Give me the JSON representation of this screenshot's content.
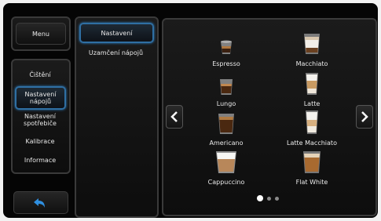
{
  "left_menu": {
    "menu_label": "Menu",
    "items": [
      {
        "label": "Čištění"
      },
      {
        "label": "Nastavení nápojů"
      },
      {
        "label": "Nastavení spotřebiče"
      },
      {
        "label": "Kalibrace"
      },
      {
        "label": "Informace"
      }
    ]
  },
  "sub_menu": {
    "items": [
      {
        "label": "Nastavení"
      },
      {
        "label": "Uzamčení nápojů"
      }
    ]
  },
  "drinks": [
    {
      "label": "Espresso"
    },
    {
      "label": "Macchiato"
    },
    {
      "label": "Lungo"
    },
    {
      "label": "Latte"
    },
    {
      "label": "Americano"
    },
    {
      "label": "Latte Macchiato"
    },
    {
      "label": "Cappuccino"
    },
    {
      "label": "Flat White"
    }
  ],
  "pagination": {
    "current_page": 1,
    "total_pages": 3
  },
  "colors": {
    "accent": "#2f6fa3",
    "back_arrow": "#2f8fe0"
  },
  "icons": {
    "prev": "chevron-left-icon",
    "next": "chevron-right-icon",
    "back": "back-arrow-icon"
  }
}
